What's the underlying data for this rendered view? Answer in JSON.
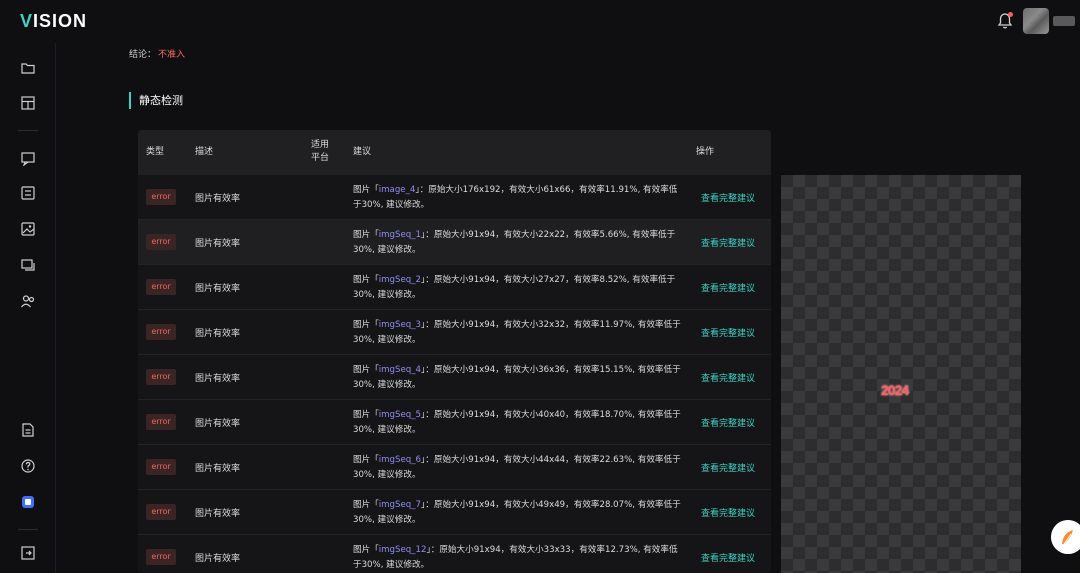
{
  "app": {
    "logo_accent": "V",
    "logo_rest": "ISION"
  },
  "sidebar": {
    "icons": [
      "folder-icon",
      "layout-icon",
      "message-icon",
      "checklist-icon",
      "image-icon",
      "layers-icon",
      "users-icon",
      "document-icon",
      "help-icon",
      "app-icon",
      "logout-icon"
    ]
  },
  "conclusion": {
    "label": "结论：",
    "value": "不准入"
  },
  "section": {
    "title": "静态检测"
  },
  "table": {
    "headers": {
      "type": "类型",
      "desc": "描述",
      "platform_line1": "适用",
      "platform_line2": "平台",
      "suggestion": "建议",
      "action": "操作"
    },
    "rows": [
      {
        "type": "error",
        "desc": "图片有效率",
        "pre": "图片「",
        "name": "image_4",
        "post": "」：原始大小176x192，有效大小61x66，有效率11.91%, 有效率低于30%, 建议修改。",
        "action": "查看完整建议"
      },
      {
        "type": "error",
        "desc": "图片有效率",
        "pre": "图片「",
        "name": "imgSeq_1",
        "post": "」：原始大小91x94，有效大小22x22，有效率5.66%, 有效率低于30%, 建议修改。",
        "action": "查看完整建议"
      },
      {
        "type": "error",
        "desc": "图片有效率",
        "pre": "图片「",
        "name": "imgSeq_2",
        "post": "」：原始大小91x94，有效大小27x27，有效率8.52%, 有效率低于30%, 建议修改。",
        "action": "查看完整建议"
      },
      {
        "type": "error",
        "desc": "图片有效率",
        "pre": "图片「",
        "name": "imgSeq_3",
        "post": "」：原始大小91x94，有效大小32x32，有效率11.97%, 有效率低于30%, 建议修改。",
        "action": "查看完整建议"
      },
      {
        "type": "error",
        "desc": "图片有效率",
        "pre": "图片「",
        "name": "imgSeq_4",
        "post": "」：原始大小91x94，有效大小36x36，有效率15.15%, 有效率低于30%, 建议修改。",
        "action": "查看完整建议"
      },
      {
        "type": "error",
        "desc": "图片有效率",
        "pre": "图片「",
        "name": "imgSeq_5",
        "post": "」：原始大小91x94，有效大小40x40，有效率18.70%, 有效率低于30%, 建议修改。",
        "action": "查看完整建议"
      },
      {
        "type": "error",
        "desc": "图片有效率",
        "pre": "图片「",
        "name": "imgSeq_6",
        "post": "」：原始大小91x94，有效大小44x44，有效率22.63%, 有效率低于30%, 建议修改。",
        "action": "查看完整建议"
      },
      {
        "type": "error",
        "desc": "图片有效率",
        "pre": "图片「",
        "name": "imgSeq_7",
        "post": "」：原始大小91x94，有效大小49x49，有效率28.07%, 有效率低于30%, 建议修改。",
        "action": "查看完整建议"
      },
      {
        "type": "error",
        "desc": "图片有效率",
        "pre": "图片「",
        "name": "imgSeq_12",
        "post": "」：原始大小91x94，有效大小33x33，有效率12.73%, 有效率低于30%, 建议修改。",
        "action": "查看完整建议"
      }
    ]
  },
  "preview": {
    "sprite_text": "2024"
  },
  "colors": {
    "accent": "#3ad1c6",
    "error": "#e86a5e",
    "link_name": "#8e8ff2",
    "conclusion": "#ff6b5e"
  }
}
